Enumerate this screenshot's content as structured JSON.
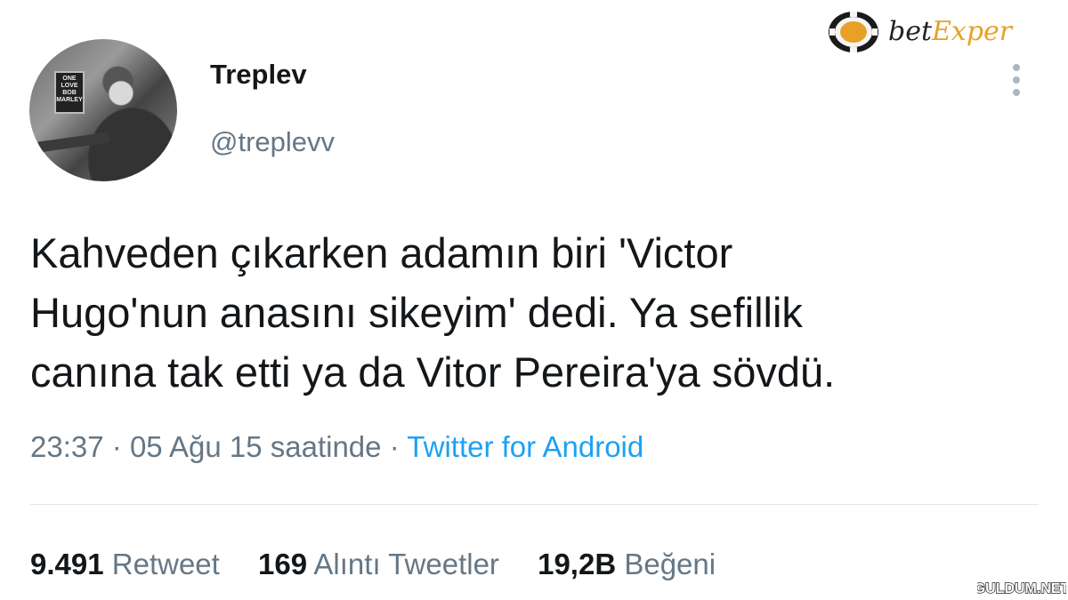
{
  "author": {
    "display_name": "Treplev",
    "handle": "@treplevv",
    "avatar_poster_text": "ONE LOVE\nBOB MARLEY"
  },
  "brand_logo": {
    "prefix": "bet",
    "suffix": "Exper",
    "color": "#e8a126"
  },
  "tweet": {
    "lines": [
      "Kahveden çıkarken adamın biri 'Victor",
      "Hugo'nun anasını sikeyim' dedi. Ya sefillik",
      "canına tak etti ya da Vitor Pereira'ya sövdü."
    ],
    "time": "23:37",
    "separator": "·",
    "date": "05 Ağu 15 saatinde",
    "source": "Twitter for Android"
  },
  "stats": {
    "retweets_count": "9.491",
    "retweets_label": "Retweet",
    "quotes_count": "169",
    "quotes_label": "Alıntı Tweetler",
    "likes_count": "19,2B",
    "likes_label": "Beğeni"
  },
  "watermark": "GULDUM.NET",
  "colors": {
    "text": "#14171a",
    "secondary": "#657786",
    "link": "#1da1f2",
    "divider": "#e1e8ed"
  },
  "icons": [
    "more-vertical-icon",
    "poker-chip-icon"
  ]
}
